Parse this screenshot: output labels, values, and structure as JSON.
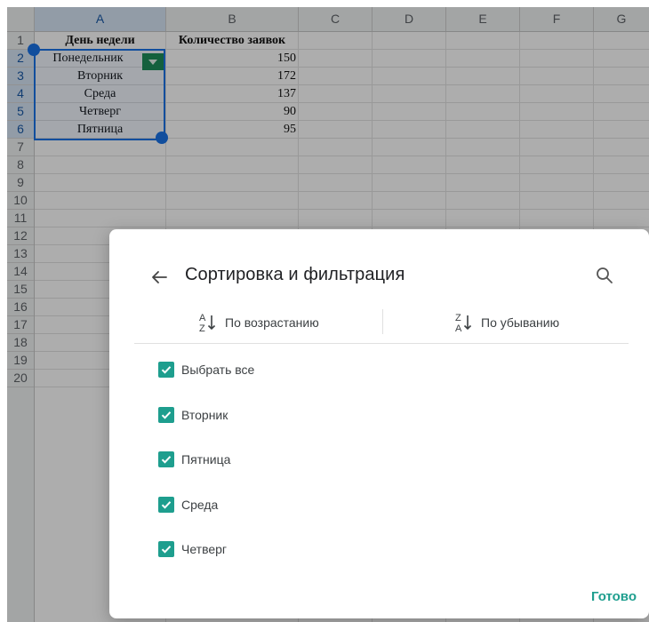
{
  "sheet": {
    "columns": [
      "A",
      "B",
      "C",
      "D",
      "E",
      "F",
      "G"
    ],
    "rows": [
      "1",
      "2",
      "3",
      "4",
      "5",
      "6",
      "7",
      "8",
      "9",
      "10",
      "11",
      "12",
      "13",
      "14",
      "15",
      "16",
      "17",
      "18",
      "19",
      "20"
    ],
    "header": {
      "col_a": "День недели",
      "col_b": "Количество заявок"
    },
    "data": [
      {
        "day": "Понедельник",
        "count": "150"
      },
      {
        "day": "Вторник",
        "count": "172"
      },
      {
        "day": "Среда",
        "count": "137"
      },
      {
        "day": "Четверг",
        "count": "90"
      },
      {
        "day": "Пятница",
        "count": "95"
      }
    ]
  },
  "dialog": {
    "title": "Сортировка и фильтрация",
    "sort_asc": "По возрастанию",
    "sort_desc": "По убыванию",
    "filter_items": [
      {
        "label": "Выбрать все",
        "checked": true
      },
      {
        "label": "Вторник",
        "checked": true
      },
      {
        "label": "Пятница",
        "checked": true
      },
      {
        "label": "Среда",
        "checked": true
      },
      {
        "label": "Четверг",
        "checked": true
      }
    ],
    "done": "Готово"
  },
  "colors": {
    "accent": "#1e9e8e",
    "selection": "#1a73e8",
    "filter_button": "#1e8e5a"
  }
}
